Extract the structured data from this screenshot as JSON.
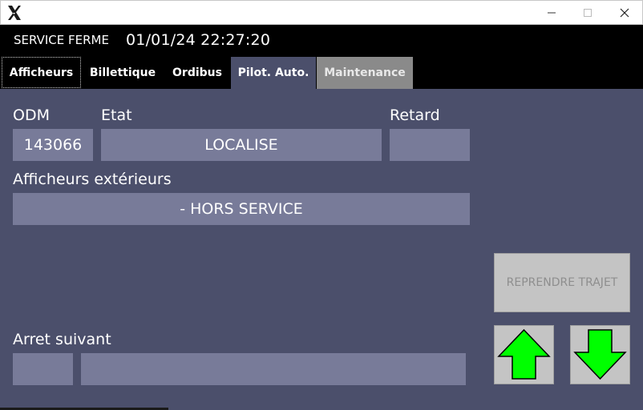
{
  "window": {
    "minimize_glyph": "—",
    "maximize_glyph": "☐",
    "close_glyph": "✕"
  },
  "header": {
    "service_status": "SERVICE FERME",
    "datetime": "01/01/24 22:27:20"
  },
  "tabs": [
    {
      "label": "Afficheurs"
    },
    {
      "label": "Billettique"
    },
    {
      "label": "Ordibus"
    },
    {
      "label": "Pilot. Auto."
    },
    {
      "label": "Maintenance"
    }
  ],
  "main": {
    "odm_label": "ODM",
    "odm_value": "143066",
    "etat_label": "Etat",
    "etat_value": "LOCALISE",
    "retard_label": "Retard",
    "retard_value": "",
    "afficheurs_label": "Afficheurs extérieurs",
    "afficheurs_value": "- HORS SERVICE",
    "arret_label": "Arret suivant",
    "arret_code": "",
    "arret_name": ""
  },
  "actions": {
    "reprendre_label": "REPRENDRE TRAJET"
  },
  "icons": {
    "app": "x-logo-icon",
    "up": "arrow-up-icon",
    "down": "arrow-down-icon"
  },
  "colors": {
    "panel": "#4b4f6b",
    "field": "#787b99",
    "arrow": "#00ff00"
  }
}
